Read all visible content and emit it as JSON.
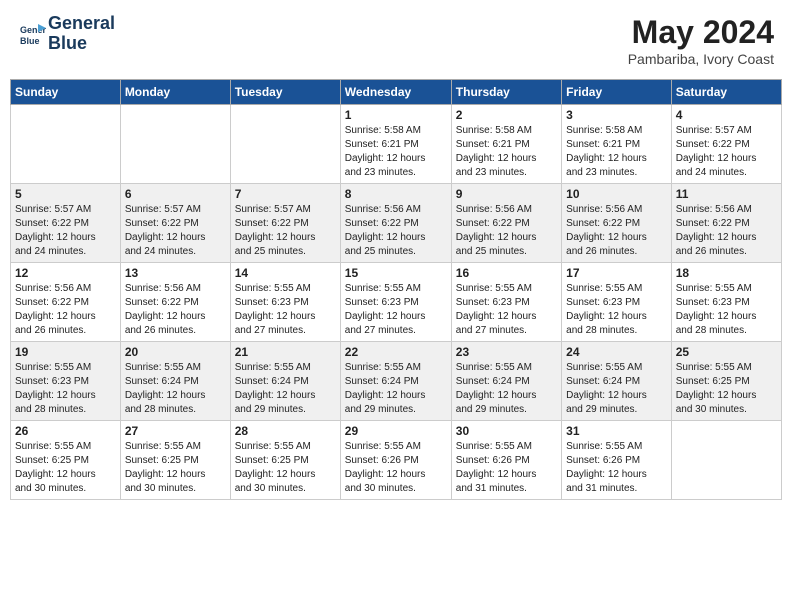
{
  "header": {
    "logo_line1": "General",
    "logo_line2": "Blue",
    "month_year": "May 2024",
    "location": "Pambariba, Ivory Coast"
  },
  "days_of_week": [
    "Sunday",
    "Monday",
    "Tuesday",
    "Wednesday",
    "Thursday",
    "Friday",
    "Saturday"
  ],
  "weeks": [
    [
      {
        "day": "",
        "info": ""
      },
      {
        "day": "",
        "info": ""
      },
      {
        "day": "",
        "info": ""
      },
      {
        "day": "1",
        "info": "Sunrise: 5:58 AM\nSunset: 6:21 PM\nDaylight: 12 hours\nand 23 minutes."
      },
      {
        "day": "2",
        "info": "Sunrise: 5:58 AM\nSunset: 6:21 PM\nDaylight: 12 hours\nand 23 minutes."
      },
      {
        "day": "3",
        "info": "Sunrise: 5:58 AM\nSunset: 6:21 PM\nDaylight: 12 hours\nand 23 minutes."
      },
      {
        "day": "4",
        "info": "Sunrise: 5:57 AM\nSunset: 6:22 PM\nDaylight: 12 hours\nand 24 minutes."
      }
    ],
    [
      {
        "day": "5",
        "info": "Sunrise: 5:57 AM\nSunset: 6:22 PM\nDaylight: 12 hours\nand 24 minutes."
      },
      {
        "day": "6",
        "info": "Sunrise: 5:57 AM\nSunset: 6:22 PM\nDaylight: 12 hours\nand 24 minutes."
      },
      {
        "day": "7",
        "info": "Sunrise: 5:57 AM\nSunset: 6:22 PM\nDaylight: 12 hours\nand 25 minutes."
      },
      {
        "day": "8",
        "info": "Sunrise: 5:56 AM\nSunset: 6:22 PM\nDaylight: 12 hours\nand 25 minutes."
      },
      {
        "day": "9",
        "info": "Sunrise: 5:56 AM\nSunset: 6:22 PM\nDaylight: 12 hours\nand 25 minutes."
      },
      {
        "day": "10",
        "info": "Sunrise: 5:56 AM\nSunset: 6:22 PM\nDaylight: 12 hours\nand 26 minutes."
      },
      {
        "day": "11",
        "info": "Sunrise: 5:56 AM\nSunset: 6:22 PM\nDaylight: 12 hours\nand 26 minutes."
      }
    ],
    [
      {
        "day": "12",
        "info": "Sunrise: 5:56 AM\nSunset: 6:22 PM\nDaylight: 12 hours\nand 26 minutes."
      },
      {
        "day": "13",
        "info": "Sunrise: 5:56 AM\nSunset: 6:22 PM\nDaylight: 12 hours\nand 26 minutes."
      },
      {
        "day": "14",
        "info": "Sunrise: 5:55 AM\nSunset: 6:23 PM\nDaylight: 12 hours\nand 27 minutes."
      },
      {
        "day": "15",
        "info": "Sunrise: 5:55 AM\nSunset: 6:23 PM\nDaylight: 12 hours\nand 27 minutes."
      },
      {
        "day": "16",
        "info": "Sunrise: 5:55 AM\nSunset: 6:23 PM\nDaylight: 12 hours\nand 27 minutes."
      },
      {
        "day": "17",
        "info": "Sunrise: 5:55 AM\nSunset: 6:23 PM\nDaylight: 12 hours\nand 28 minutes."
      },
      {
        "day": "18",
        "info": "Sunrise: 5:55 AM\nSunset: 6:23 PM\nDaylight: 12 hours\nand 28 minutes."
      }
    ],
    [
      {
        "day": "19",
        "info": "Sunrise: 5:55 AM\nSunset: 6:23 PM\nDaylight: 12 hours\nand 28 minutes."
      },
      {
        "day": "20",
        "info": "Sunrise: 5:55 AM\nSunset: 6:24 PM\nDaylight: 12 hours\nand 28 minutes."
      },
      {
        "day": "21",
        "info": "Sunrise: 5:55 AM\nSunset: 6:24 PM\nDaylight: 12 hours\nand 29 minutes."
      },
      {
        "day": "22",
        "info": "Sunrise: 5:55 AM\nSunset: 6:24 PM\nDaylight: 12 hours\nand 29 minutes."
      },
      {
        "day": "23",
        "info": "Sunrise: 5:55 AM\nSunset: 6:24 PM\nDaylight: 12 hours\nand 29 minutes."
      },
      {
        "day": "24",
        "info": "Sunrise: 5:55 AM\nSunset: 6:24 PM\nDaylight: 12 hours\nand 29 minutes."
      },
      {
        "day": "25",
        "info": "Sunrise: 5:55 AM\nSunset: 6:25 PM\nDaylight: 12 hours\nand 30 minutes."
      }
    ],
    [
      {
        "day": "26",
        "info": "Sunrise: 5:55 AM\nSunset: 6:25 PM\nDaylight: 12 hours\nand 30 minutes."
      },
      {
        "day": "27",
        "info": "Sunrise: 5:55 AM\nSunset: 6:25 PM\nDaylight: 12 hours\nand 30 minutes."
      },
      {
        "day": "28",
        "info": "Sunrise: 5:55 AM\nSunset: 6:25 PM\nDaylight: 12 hours\nand 30 minutes."
      },
      {
        "day": "29",
        "info": "Sunrise: 5:55 AM\nSunset: 6:26 PM\nDaylight: 12 hours\nand 30 minutes."
      },
      {
        "day": "30",
        "info": "Sunrise: 5:55 AM\nSunset: 6:26 PM\nDaylight: 12 hours\nand 31 minutes."
      },
      {
        "day": "31",
        "info": "Sunrise: 5:55 AM\nSunset: 6:26 PM\nDaylight: 12 hours\nand 31 minutes."
      },
      {
        "day": "",
        "info": ""
      }
    ]
  ]
}
